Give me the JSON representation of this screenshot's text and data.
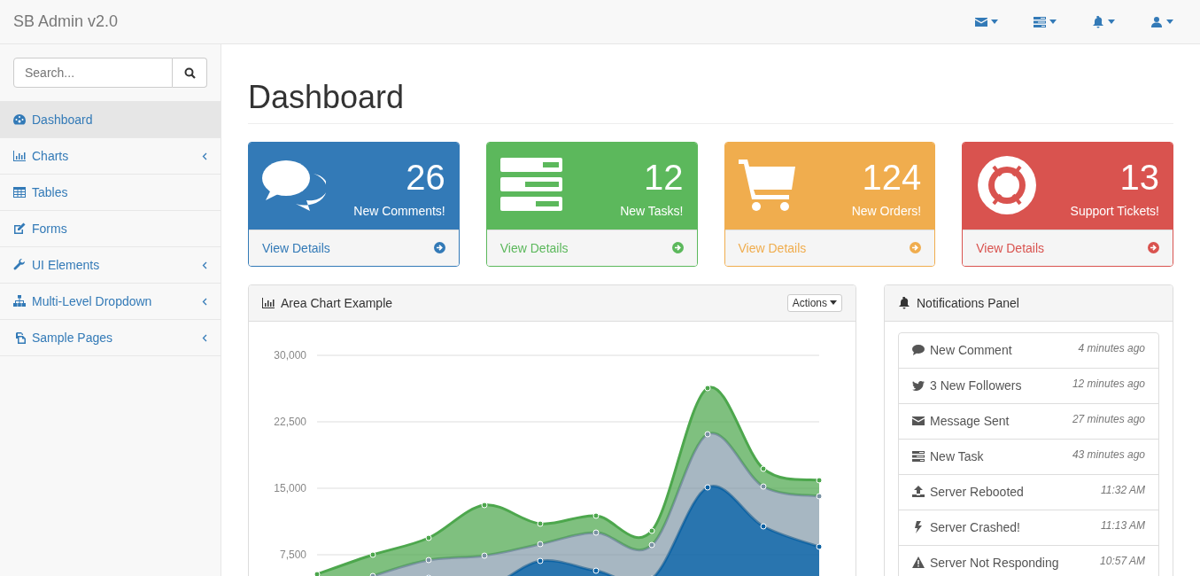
{
  "navbar": {
    "brand": "SB Admin v2.0"
  },
  "sidebar": {
    "search": {
      "placeholder": "Search..."
    },
    "items": [
      {
        "kind": "link",
        "label": "Dashboard",
        "selected": true
      },
      {
        "kind": "submenu",
        "label": "Charts",
        "selected": false
      },
      {
        "kind": "link",
        "label": "Tables",
        "selected": false
      },
      {
        "kind": "link",
        "label": "Forms",
        "selected": false
      },
      {
        "kind": "submenu",
        "label": "UI Elements",
        "selected": false
      },
      {
        "kind": "submenu",
        "label": "Multi-Level Dropdown",
        "selected": false
      },
      {
        "kind": "submenu",
        "label": "Sample Pages",
        "selected": false
      }
    ]
  },
  "page_title": "Dashboard",
  "stat_cards": [
    {
      "count": "26",
      "label": "New Comments!",
      "link": "View Details",
      "color": "#337ab7"
    },
    {
      "count": "12",
      "label": "New Tasks!",
      "link": "View Details",
      "color": "#5cb85c"
    },
    {
      "count": "124",
      "label": "New Orders!",
      "link": "View Details",
      "color": "#f0ad4e"
    },
    {
      "count": "13",
      "label": "Support Tickets!",
      "link": "View Details",
      "color": "#d9534f"
    }
  ],
  "chart_panel": {
    "title": "Area Chart Example",
    "actions_button": "Actions",
    "chart_data": {
      "type": "area",
      "stacked": true,
      "grid": true,
      "ylim": [
        0,
        30000
      ],
      "yticks": [
        {
          "value": 7500,
          "label": "7,500"
        },
        {
          "value": 15000,
          "label": "15,000"
        },
        {
          "value": 22500,
          "label": "22,500"
        },
        {
          "value": 30000,
          "label": "30,000"
        }
      ],
      "series": [
        {
          "color": "#0b62a4",
          "values": [
            2700,
            2800,
            4900,
            3800,
            6800,
            5700,
            4800,
            15100,
            10700,
            8400
          ]
        },
        {
          "color": "#7a92a3",
          "values": [
            0,
            2300,
            2000,
            3600,
            1900,
            4300,
            3800,
            6000,
            4500,
            5700
          ]
        },
        {
          "color": "#4da74d",
          "values": [
            2600,
            2400,
            2500,
            5700,
            2300,
            1900,
            1600,
            5200,
            2000,
            1800
          ]
        }
      ]
    }
  },
  "notifications_panel": {
    "title": "Notifications Panel",
    "items": [
      {
        "text": "New Comment",
        "time": "4 minutes ago"
      },
      {
        "text": "3 New Followers",
        "time": "12 minutes ago"
      },
      {
        "text": "Message Sent",
        "time": "27 minutes ago"
      },
      {
        "text": "New Task",
        "time": "43 minutes ago"
      },
      {
        "text": "Server Rebooted",
        "time": "11:32 AM"
      },
      {
        "text": "Server Crashed!",
        "time": "11:13 AM"
      },
      {
        "text": "Server Not Responding",
        "time": "10:57 AM"
      }
    ]
  }
}
